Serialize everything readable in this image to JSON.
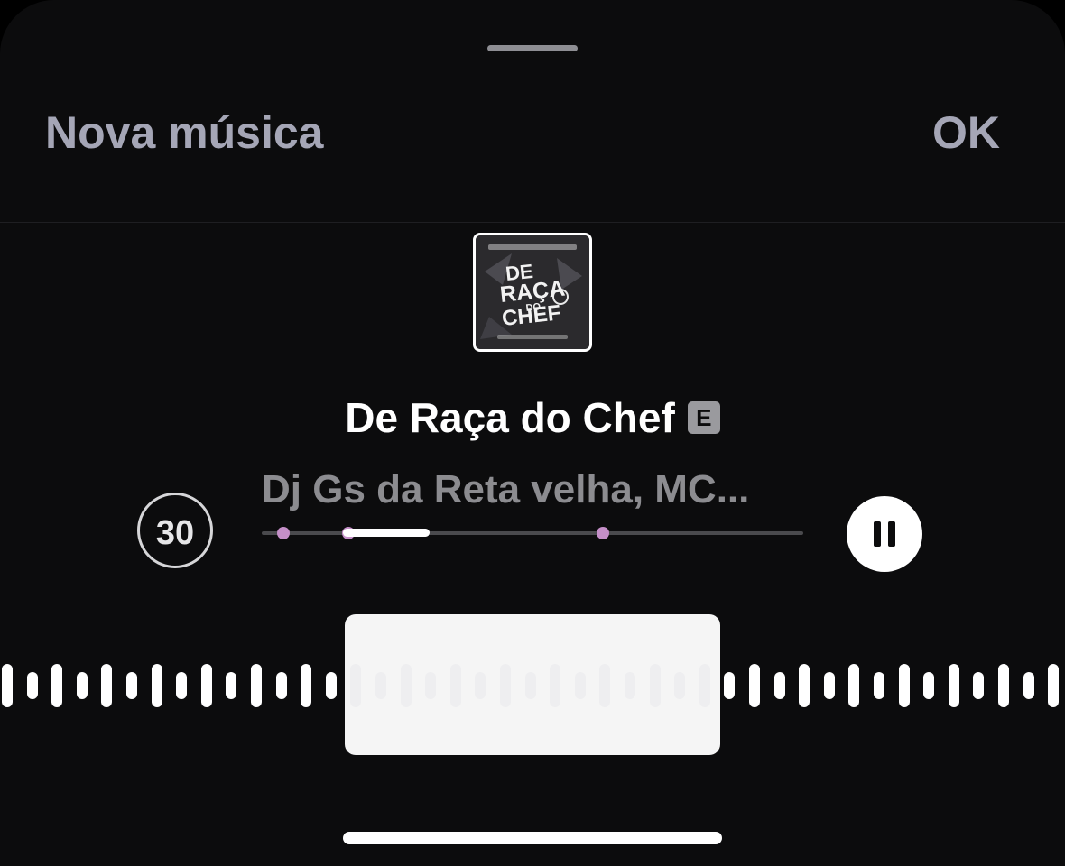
{
  "header": {
    "left_label": "Nova música",
    "right_label": "OK"
  },
  "track": {
    "cover_art_text": [
      "DE",
      "RAÇA",
      "DO",
      "CHEF"
    ],
    "title": "De Raça do Chef",
    "explicit_badge": "E",
    "artist": "Dj Gs da Reta velha, MC..."
  },
  "controls": {
    "replay_label": "30",
    "pause_icon": "pause-icon"
  },
  "scrubber": {
    "progress_start": 0.15,
    "progress_end": 0.31,
    "markers": [
      0.04,
      0.16,
      0.63
    ],
    "marker_color": "#c58fc8"
  },
  "waveform": {
    "selection_start": 0.324,
    "selection_end": 0.676
  },
  "colors": {
    "background": "#000000",
    "header_text": "#a5a6b6",
    "secondary_text": "#8c8c90",
    "accent": "#ffffff"
  }
}
